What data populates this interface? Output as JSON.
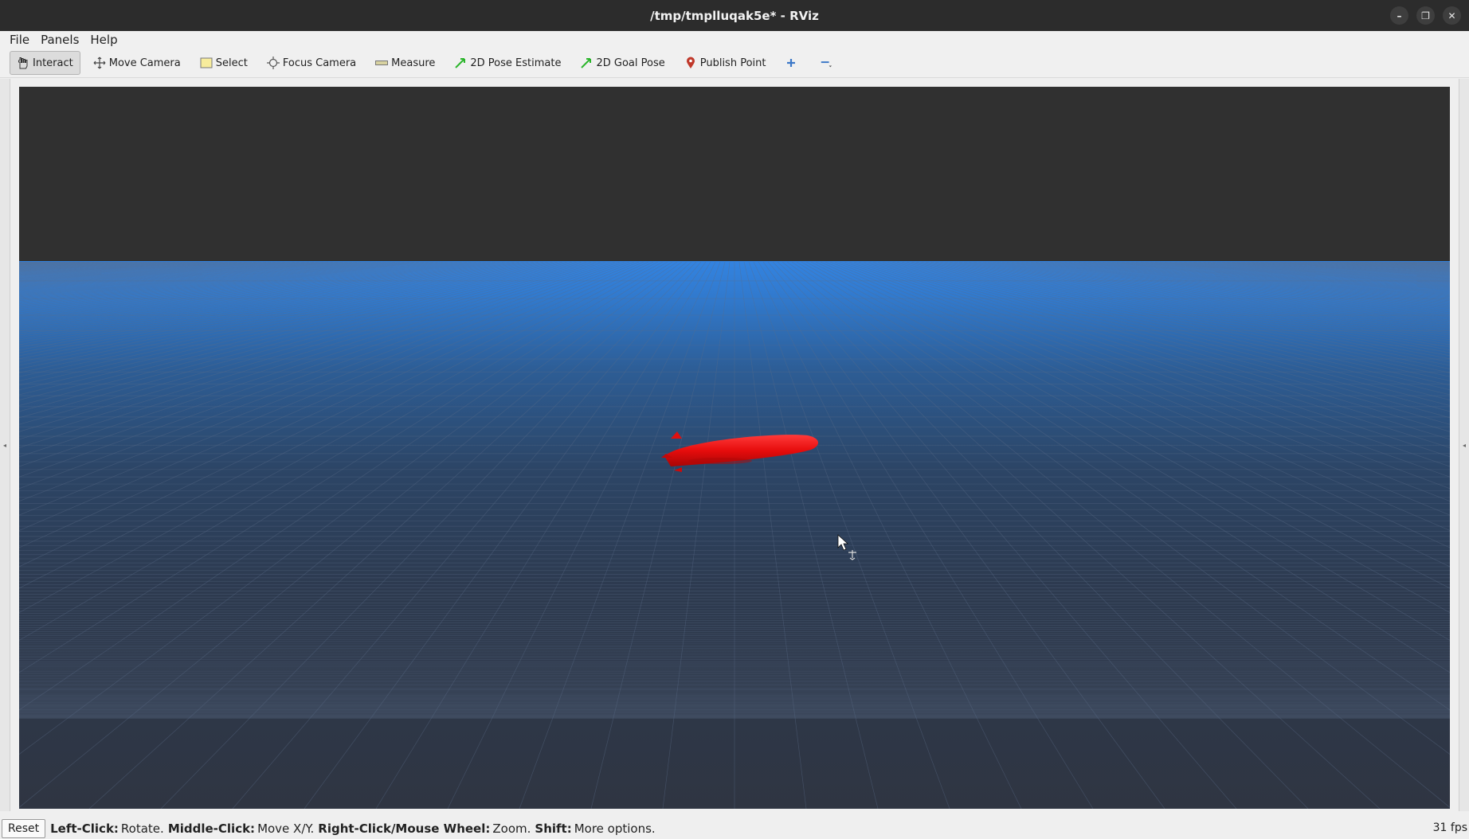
{
  "window": {
    "title": "/tmp/tmplluqak5e* - RViz",
    "controls": {
      "minimize": "–",
      "restore": "❐",
      "close": "✕"
    }
  },
  "menubar": {
    "items": [
      {
        "label": "File"
      },
      {
        "label": "Panels"
      },
      {
        "label": "Help"
      }
    ]
  },
  "toolbar": {
    "tools": [
      {
        "label": "Interact",
        "icon": "hand-icon",
        "active": true
      },
      {
        "label": "Move Camera",
        "icon": "move-camera-icon"
      },
      {
        "label": "Select",
        "icon": "select-icon"
      },
      {
        "label": "Focus Camera",
        "icon": "focus-camera-icon"
      },
      {
        "label": "Measure",
        "icon": "ruler-icon"
      },
      {
        "label": "2D Pose Estimate",
        "icon": "arrow-green-icon"
      },
      {
        "label": "2D Goal Pose",
        "icon": "arrow-green-icon"
      },
      {
        "label": "Publish Point",
        "icon": "map-pin-icon"
      }
    ],
    "add_tool_icon": "plus-icon",
    "remove_tool_icon": "minus-icon"
  },
  "scene": {
    "background_color": "#303030",
    "horizon_color": "#3383e0",
    "ground_color": "#2f3542",
    "grid_color": "#5a6c88",
    "model_color": "#e20a0a"
  },
  "statusbar": {
    "reset_label": "Reset",
    "hints": [
      {
        "key": "Left-Click:",
        "value": "Rotate."
      },
      {
        "key": "Middle-Click:",
        "value": "Move X/Y."
      },
      {
        "key": "Right-Click/Mouse Wheel:",
        "value": "Zoom."
      },
      {
        "key": "Shift:",
        "value": "More options."
      }
    ],
    "fps": "31 fps"
  }
}
